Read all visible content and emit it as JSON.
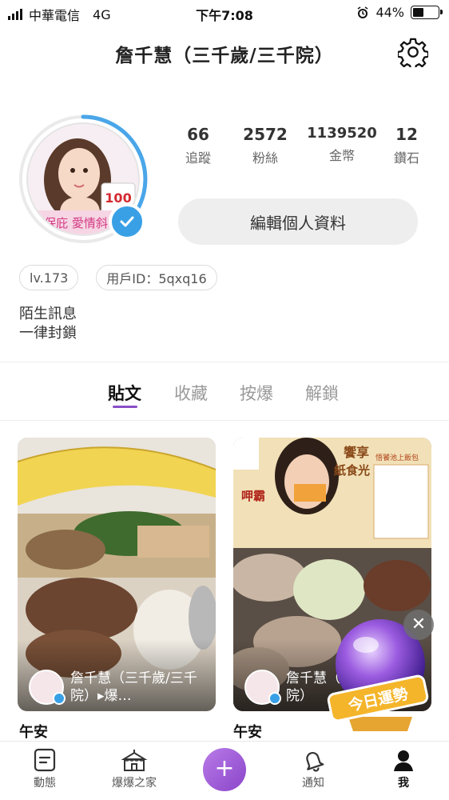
{
  "status_bar": {
    "carrier": "中華電信",
    "network": "4G",
    "time": "下午7:08",
    "battery": "44%",
    "battery_level": 0.44
  },
  "header": {
    "title": "詹千慧（三千歲/三千院）",
    "settings_icon": "gear-icon"
  },
  "profile": {
    "avatar_badge": "100",
    "avatar_sticker": "保庇 愛情斜",
    "stats": [
      {
        "value": "66",
        "label": "追蹤"
      },
      {
        "value": "2572",
        "label": "粉絲"
      },
      {
        "value": "1139520",
        "label": "金幣"
      },
      {
        "value": "12",
        "label": "鑽石"
      }
    ],
    "edit_button": "編輯個人資料",
    "level": "lv.173",
    "user_id": "用戶ID：5qxq16",
    "bio_lines": [
      "陌生訊息",
      "一律封鎖"
    ]
  },
  "tabs": [
    {
      "label": "貼文",
      "active": true
    },
    {
      "label": "收藏",
      "active": false
    },
    {
      "label": "按爆",
      "active": false
    },
    {
      "label": "解鎖",
      "active": false
    }
  ],
  "posts": [
    {
      "author": "詹千慧（三千歲/三千院）▸爆…",
      "caption": "午安"
    },
    {
      "author": "詹千慧（三千歲/三千院）",
      "caption": "午安",
      "ad_texts": [
        "饗享",
        "紙食光",
        "悟饕池上飯包",
        "呷霸"
      ]
    }
  ],
  "fortune": {
    "label": "今日運勢",
    "close": "✕"
  },
  "bottom_nav": [
    {
      "label": "動態",
      "icon": "feed-icon"
    },
    {
      "label": "爆爆之家",
      "icon": "tent-icon"
    },
    {
      "label": "+",
      "icon": "plus-icon"
    },
    {
      "label": "通知",
      "icon": "bell-icon"
    },
    {
      "label": "我",
      "icon": "user-icon",
      "active": true
    }
  ],
  "colors": {
    "accent": "#8a4fc7",
    "verified": "#3aa0e6",
    "ring": "#4aa6e8"
  }
}
